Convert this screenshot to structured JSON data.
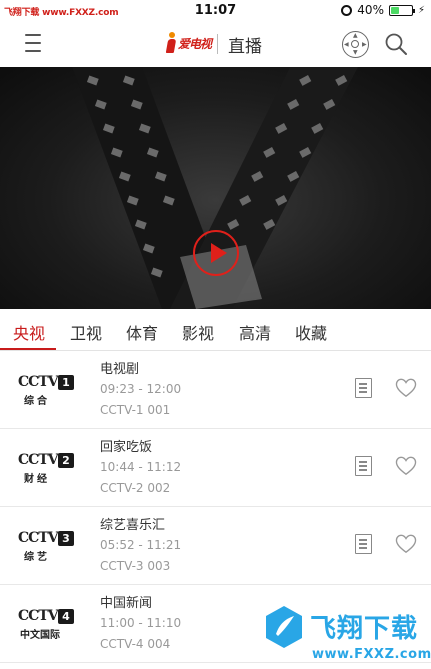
{
  "status_bar": {
    "watermark_text": "飞翔下载 www.FXXZ.com",
    "time": "11:07",
    "battery_percent_text": "40%",
    "battery_level": 0.4
  },
  "header": {
    "logo_text": "爱电视",
    "title": "直播",
    "icons": [
      "menu-icon",
      "remote-icon",
      "search-icon"
    ]
  },
  "hero": {
    "play_icon": "play-icon",
    "accent_color": "#e0201a"
  },
  "tabs": [
    {
      "label": "央视",
      "active": true
    },
    {
      "label": "卫视",
      "active": false
    },
    {
      "label": "体育",
      "active": false
    },
    {
      "label": "影视",
      "active": false
    },
    {
      "label": "高清",
      "active": false
    },
    {
      "label": "收藏",
      "active": false
    }
  ],
  "channels": [
    {
      "logo_main": "CCTV",
      "logo_num": "1",
      "logo_sub": "综合",
      "program": "电视剧",
      "time": "09:23 - 12:00",
      "code": "CCTV-1 001"
    },
    {
      "logo_main": "CCTV",
      "logo_num": "2",
      "logo_sub": "财经",
      "program": "回家吃饭",
      "time": "10:44 - 11:12",
      "code": "CCTV-2 002"
    },
    {
      "logo_main": "CCTV",
      "logo_num": "3",
      "logo_sub": "综艺",
      "program": "综艺喜乐汇",
      "time": "05:52 - 11:21",
      "code": "CCTV-3 003"
    },
    {
      "logo_main": "CCTV",
      "logo_num": "4",
      "logo_sub": "中文国际",
      "program": "中国新闻",
      "time": "11:00 - 11:10",
      "code": "CCTV-4 004"
    }
  ],
  "watermark": {
    "title": "飞翔下载",
    "url": "www.FXXZ.com"
  }
}
